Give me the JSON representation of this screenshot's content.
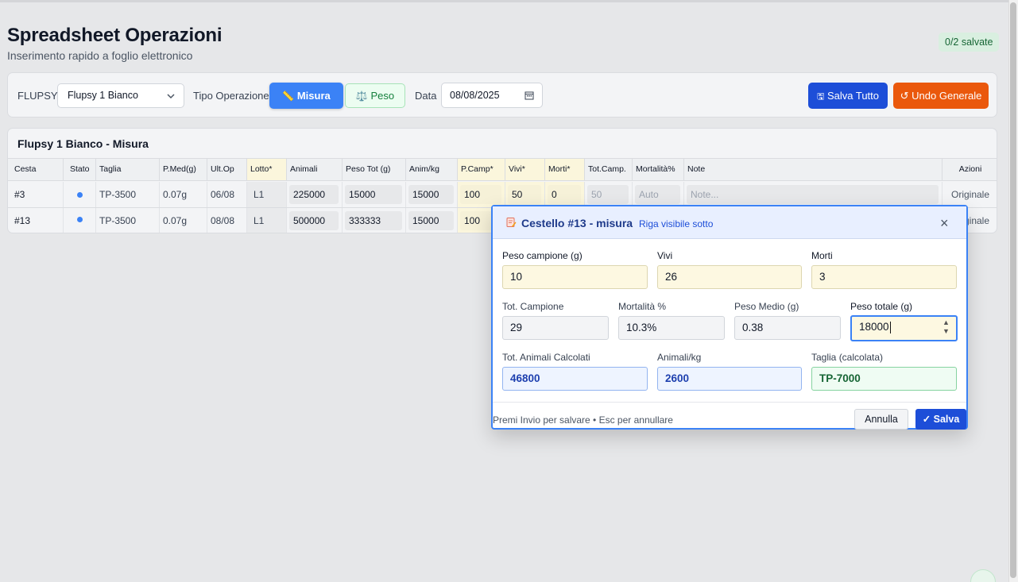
{
  "header": {
    "title": "Spreadsheet Operazioni",
    "subtitle": "Inserimento rapido a foglio elettronico",
    "saved_badge": "0/2 salvate"
  },
  "toolbar": {
    "flupsy_label": "FLUPSY",
    "flupsy_value": "Flupsy 1 Bianco",
    "tipo_label": "Tipo Operazione",
    "misura_label": "Misura",
    "peso_label": "Peso",
    "data_label": "Data",
    "data_value": "08/08/2025",
    "save_all_label": "Salva Tutto",
    "undo_label": "Undo Generale"
  },
  "sheet": {
    "title": "Flupsy 1 Bianco - Misura",
    "columns": [
      "Cesta",
      "Stato",
      "Taglia",
      "P.Med(g)",
      "Ult.Op",
      "Lotto*",
      "Animali",
      "Peso Tot (g)",
      "Anim/kg",
      "P.Camp*",
      "Vivi*",
      "Morti*",
      "Tot.Camp.",
      "Mortalità%",
      "Note",
      "Azioni"
    ],
    "rows": [
      {
        "cesta": "#3",
        "taglia": "TP-3500",
        "pmed": "0.07g",
        "ultop": "06/08",
        "lotto": "L1",
        "animali": "225000",
        "pesotot": "15000",
        "animkg": "15000",
        "pcamp": "100",
        "vivi": "50",
        "morti": "0",
        "totcamp": "50",
        "mortalita": "Auto",
        "note": "Note...",
        "azioni": "Originale"
      },
      {
        "cesta": "#13",
        "taglia": "TP-3500",
        "pmed": "0.07g",
        "ultop": "08/08",
        "lotto": "L1",
        "animali": "500000",
        "pesotot": "333333",
        "animkg": "15000",
        "pcamp": "100",
        "azioni": "Originale"
      }
    ]
  },
  "dialog": {
    "title": "Cestello #13 - misura",
    "hint": "Riga visibile sotto",
    "close": "×",
    "peso_campione_label": "Peso campione (g)",
    "peso_campione_value": "10",
    "vivi_label": "Vivi",
    "vivi_value": "26",
    "morti_label": "Morti",
    "morti_value": "3",
    "tot_campione_label": "Tot. Campione",
    "tot_campione_value": "29",
    "mortalita_label": "Mortalità %",
    "mortalita_value": "10.3%",
    "peso_medio_label": "Peso Medio (g)",
    "peso_medio_value": "0.38",
    "peso_totale_label": "Peso totale (g)",
    "peso_totale_value": "18000",
    "tot_animali_label": "Tot. Animali Calcolati",
    "tot_animali_value": "46800",
    "animali_kg_label": "Animali/kg",
    "animali_kg_value": "2600",
    "taglia_label": "Taglia (calcolata)",
    "taglia_value": "TP-7000",
    "footer_hint": "Premi Invio per salvare • Esc per annullare",
    "annulla_label": "Annulla",
    "salva_label": "✓ Salva"
  },
  "colors": {
    "primary": "#3b82f6",
    "save_blue": "#1d4ed8",
    "undo_orange": "#ea580c",
    "required_column": "#fbf6dc"
  }
}
